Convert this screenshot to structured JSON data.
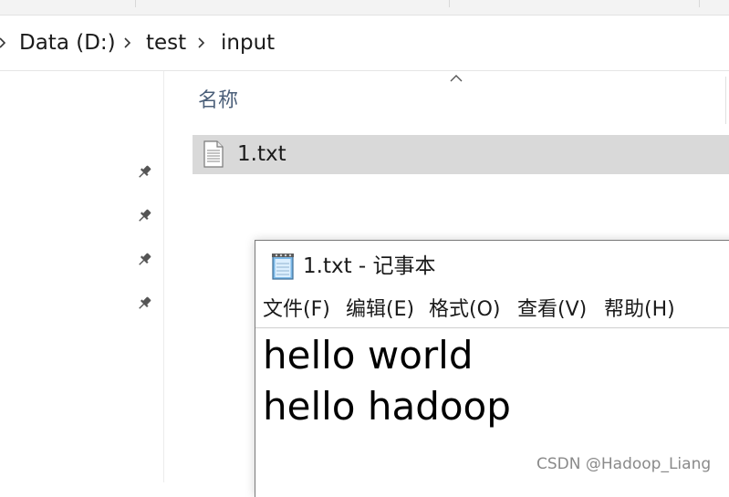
{
  "explorer": {
    "breadcrumb": [
      "Data (D:)",
      "test",
      "input"
    ],
    "column_header": "名称",
    "files": [
      {
        "name": "1.txt",
        "icon": "text-file-icon",
        "selected": true
      }
    ],
    "quick_access_pins": 4
  },
  "notepad": {
    "title": "1.txt - 记事本",
    "icon": "notepad-icon",
    "menu": [
      "文件(F)",
      "编辑(E)",
      "格式(O)",
      "查看(V)",
      "帮助(H)"
    ],
    "content_lines": [
      "hello world",
      "hello hadoop"
    ]
  },
  "watermark": "CSDN @Hadoop_Liang",
  "colors": {
    "selection": "#d9d9d9",
    "header_text": "#4c607a",
    "watermark": "#8a8a8a"
  }
}
